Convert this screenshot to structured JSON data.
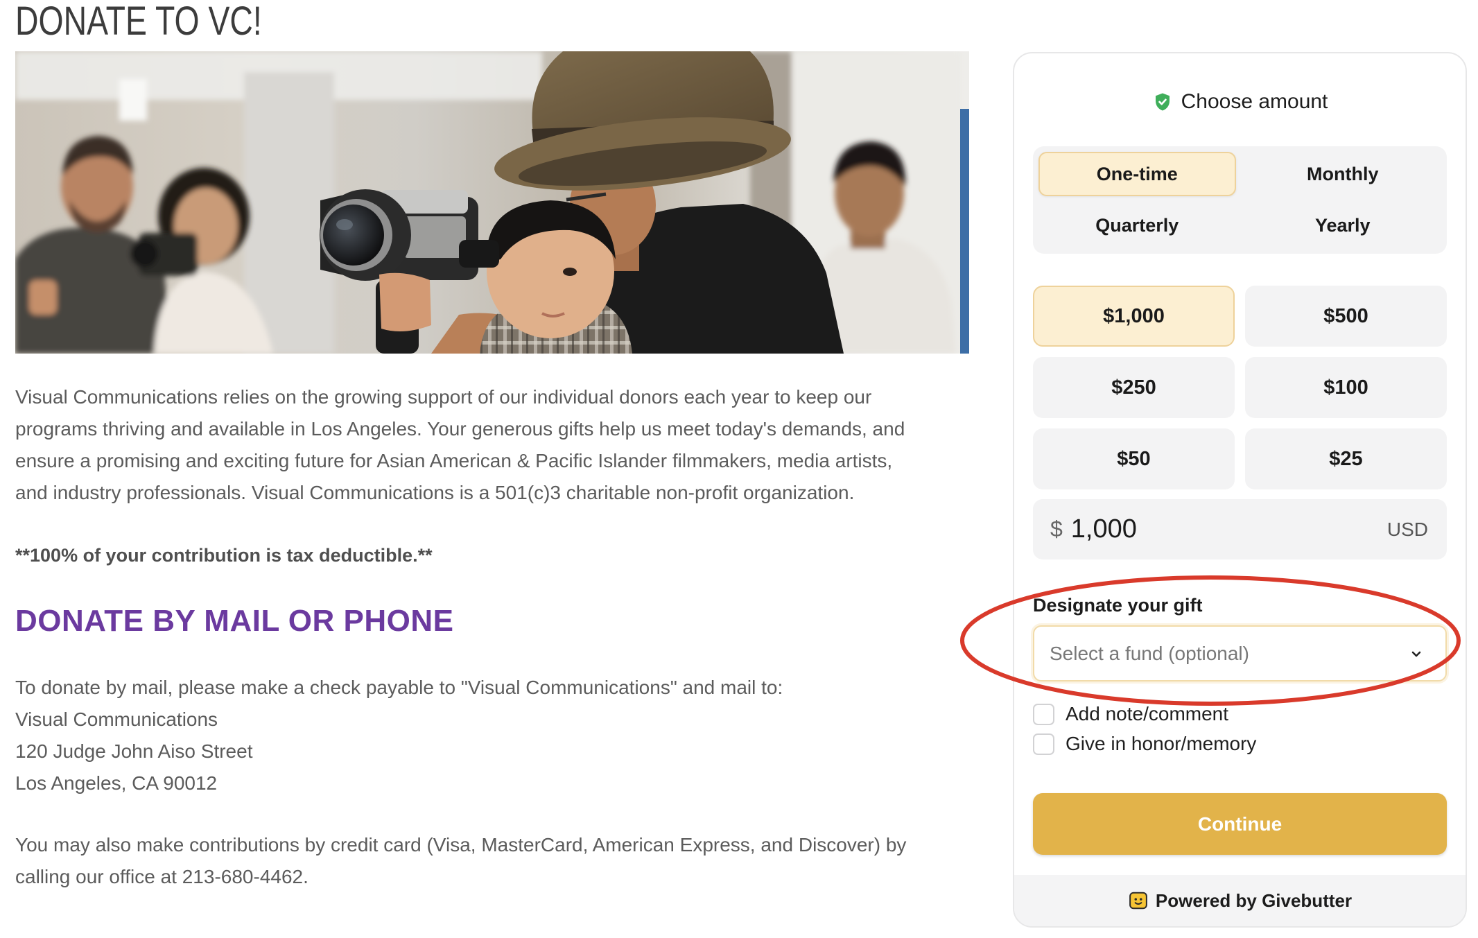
{
  "page": {
    "title": "DONATE TO VC!"
  },
  "intro": {
    "lines": [
      "Visual Communications relies on the growing support of our individual donors each year to keep our",
      "programs thriving and available in Los Angeles. Your generous gifts help us meet today's demands, and",
      "ensure a promising and exciting future for Asian American & Pacific Islander filmmakers, media artists,",
      "and industry professionals. Visual Communications is a 501(c)3 charitable non-profit organization."
    ]
  },
  "tax_note": "**100% of your contribution is tax deductible.**",
  "mail_section": {
    "heading": "DONATE BY MAIL OR PHONE",
    "instructions": "To donate by mail, please make a check payable to \"Visual Communications\" and mail to:",
    "address": [
      "Visual Communications",
      "120 Judge John Aiso Street",
      "Los Angeles, CA 90012"
    ],
    "phone_lines": [
      "You may also make contributions by credit card (Visa, MasterCard, American Express, and Discover) by",
      "calling our office at 213-680-4462."
    ]
  },
  "donation_form": {
    "heading": "Choose amount",
    "heading_icon": "shield-check-icon",
    "frequencies": [
      {
        "label": "One-time",
        "selected": true
      },
      {
        "label": "Monthly",
        "selected": false
      },
      {
        "label": "Quarterly",
        "selected": false
      },
      {
        "label": "Yearly",
        "selected": false
      }
    ],
    "amounts": [
      {
        "label": "$1,000",
        "selected": true
      },
      {
        "label": "$500",
        "selected": false
      },
      {
        "label": "$250",
        "selected": false
      },
      {
        "label": "$100",
        "selected": false
      },
      {
        "label": "$50",
        "selected": false
      },
      {
        "label": "$25",
        "selected": false
      }
    ],
    "custom_amount": {
      "currency_symbol": "$",
      "value": "1,000",
      "currency": "USD"
    },
    "designation": {
      "label": "Designate your gift",
      "placeholder": "Select a fund (optional)",
      "icon": "chevron-down-icon"
    },
    "options": [
      {
        "label": "Add note/comment",
        "checked": false
      },
      {
        "label": "Give in honor/memory",
        "checked": false
      }
    ],
    "continue_label": "Continue",
    "footer": {
      "text": "Powered by Givebutter",
      "icon": "givebutter-logo-icon"
    }
  },
  "colors": {
    "heading_purple": "#6b3a9f",
    "accent_gold": "#e2b34a",
    "selected_bg": "#fcefd2",
    "selected_border": "#eed29b",
    "tile_bg": "#f3f3f4",
    "verified_green": "#3fae5a",
    "annotation_red": "#d93a2b"
  }
}
